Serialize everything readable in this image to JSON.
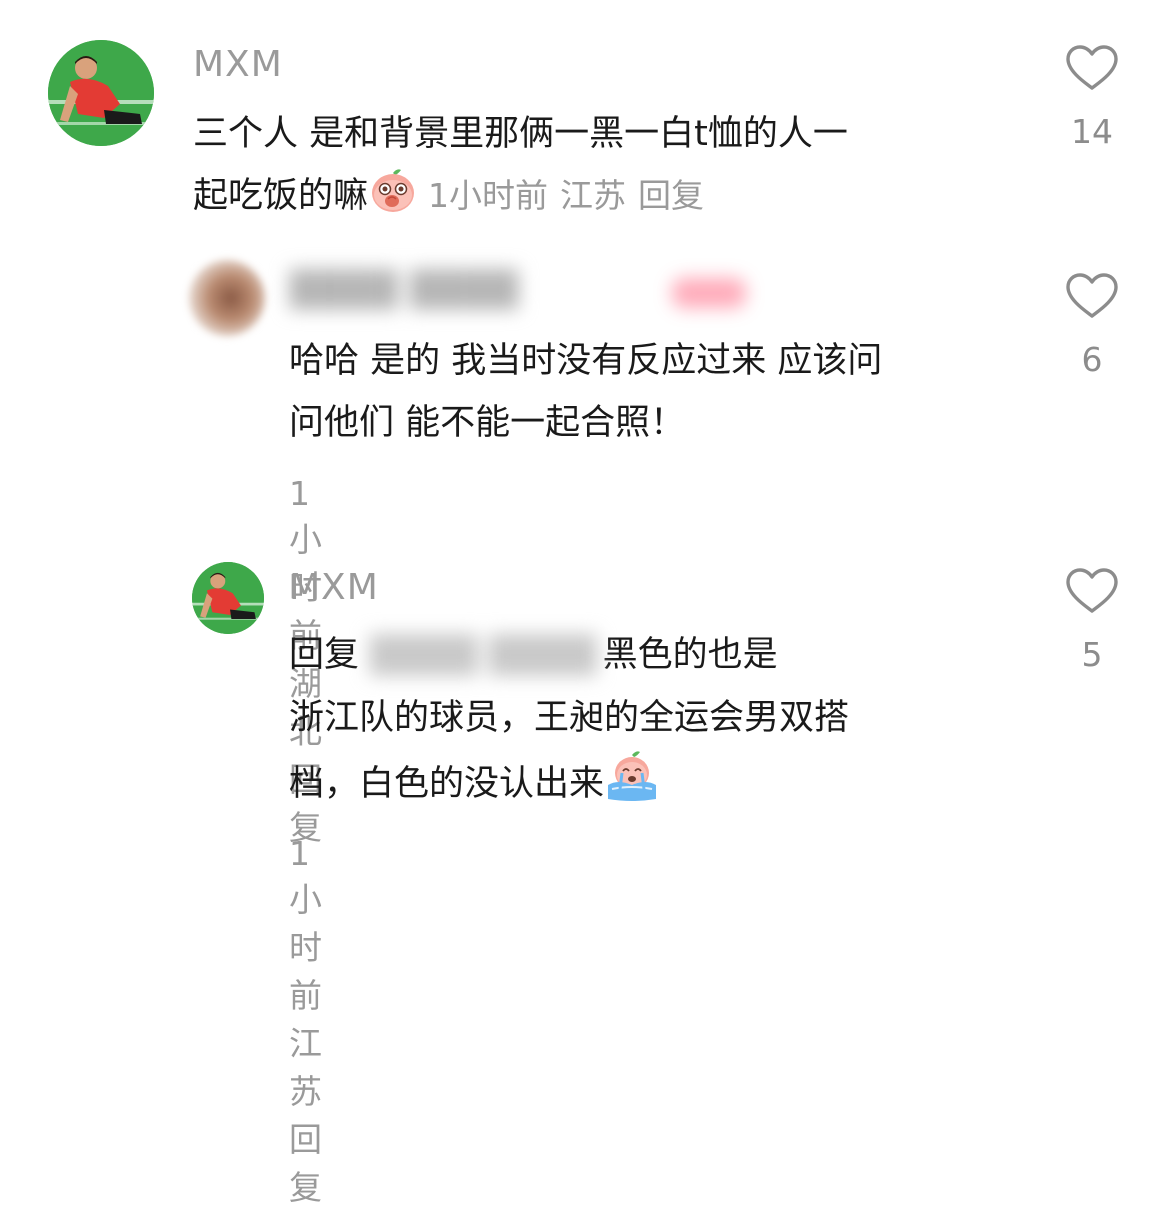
{
  "comments": [
    {
      "username": "MXM",
      "text_line1": "三个人 是和背景里那俩一黑一白t恤的人一",
      "text_line2": "起吃饭的嘛",
      "time": "1小时前",
      "location": "江苏",
      "reply_label": "回复",
      "likes": "14",
      "emoji": "peach-shy-emoji"
    },
    {
      "username": "████ ████",
      "badge": "██",
      "text_line1": "哈哈 是的 我当时没有反应过来 应该问",
      "text_line2": "问他们 能不能一起合照！",
      "time": "1小时前",
      "location": "湖北",
      "reply_label": "回复",
      "likes": "6"
    },
    {
      "username": "MXM",
      "reply_prefix": "回复",
      "blurred_mention": "████ ████",
      "text_line1_rest": "黑色的也是",
      "text_line2": "浙江队的球员，王昶的全运会男双搭",
      "text_line3": "档，白色的没认出来",
      "time": "1小时前",
      "location": "江苏",
      "reply_label": "回复",
      "likes": "5",
      "emoji": "peach-crying-emoji"
    }
  ],
  "icons": {
    "like": "heart-outline-icon"
  },
  "colors": {
    "text": "#1a1a1a",
    "muted": "#9a9a9a",
    "heart_stroke": "#8c8c8c"
  }
}
